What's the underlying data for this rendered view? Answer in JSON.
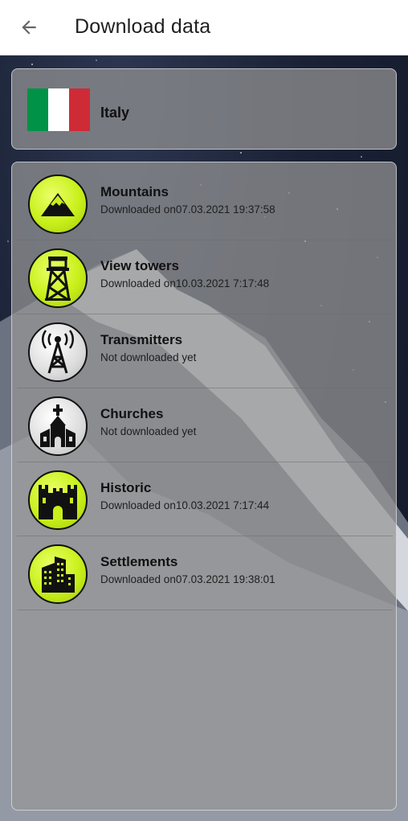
{
  "header": {
    "title": "Download data",
    "back_icon": "arrow-left-icon"
  },
  "country": {
    "name": "Italy",
    "flag_colors": [
      "#009246",
      "#ffffff",
      "#ce2b37"
    ]
  },
  "categories": [
    {
      "name": "Mountains",
      "status": "Downloaded on07.03.2021 19:37:58",
      "icon": "mountain-icon",
      "downloaded": true
    },
    {
      "name": "View towers",
      "status": "Downloaded on10.03.2021 7:17:48",
      "icon": "view-tower-icon",
      "downloaded": true
    },
    {
      "name": "Transmitters",
      "status": "Not downloaded yet",
      "icon": "transmitter-icon",
      "downloaded": false
    },
    {
      "name": "Churches",
      "status": "Not downloaded yet",
      "icon": "church-icon",
      "downloaded": false
    },
    {
      "name": "Historic",
      "status": "Downloaded on10.03.2021 7:17:44",
      "icon": "castle-icon",
      "downloaded": true
    },
    {
      "name": "Settlements",
      "status": "Downloaded on07.03.2021 19:38:01",
      "icon": "buildings-icon",
      "downloaded": true
    }
  ],
  "colors": {
    "downloaded_accent": "#c8f01a",
    "not_downloaded": "#dcdcdc"
  }
}
